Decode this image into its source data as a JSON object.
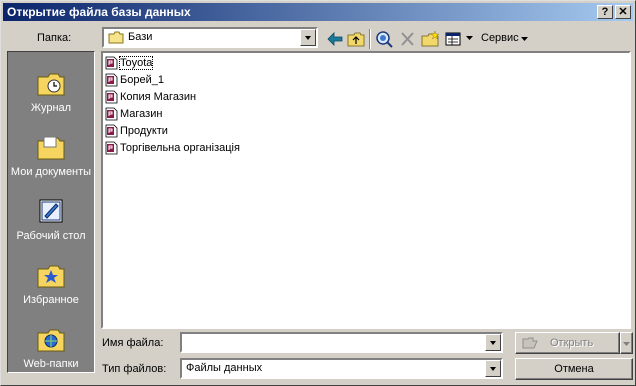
{
  "window": {
    "title": "Открытие файла базы данных",
    "help_label": "?",
    "close_label": "✕"
  },
  "toolbar": {
    "folder_label": "Папка:",
    "folder_value": "Бази",
    "service_label": "Сервис"
  },
  "places": [
    {
      "label": "Журнал",
      "icon": "history-icon"
    },
    {
      "label": "Мои документы",
      "icon": "my-documents-icon"
    },
    {
      "label": "Рабочий стол",
      "icon": "desktop-icon"
    },
    {
      "label": "Избранное",
      "icon": "favorites-icon"
    },
    {
      "label": "Web-папки",
      "icon": "web-folders-icon"
    }
  ],
  "files": [
    {
      "name": "Toyota",
      "selected": true
    },
    {
      "name": "Борей_1"
    },
    {
      "name": "Копия Магазин"
    },
    {
      "name": "Магазин"
    },
    {
      "name": "Продукти"
    },
    {
      "name": "Торгівельна організація"
    }
  ],
  "filename": {
    "label": "Имя файла:",
    "value": ""
  },
  "filetype": {
    "label": "Тип файлов:",
    "value": "Файлы данных"
  },
  "buttons": {
    "open": "Открыть",
    "cancel": "Отмена"
  }
}
